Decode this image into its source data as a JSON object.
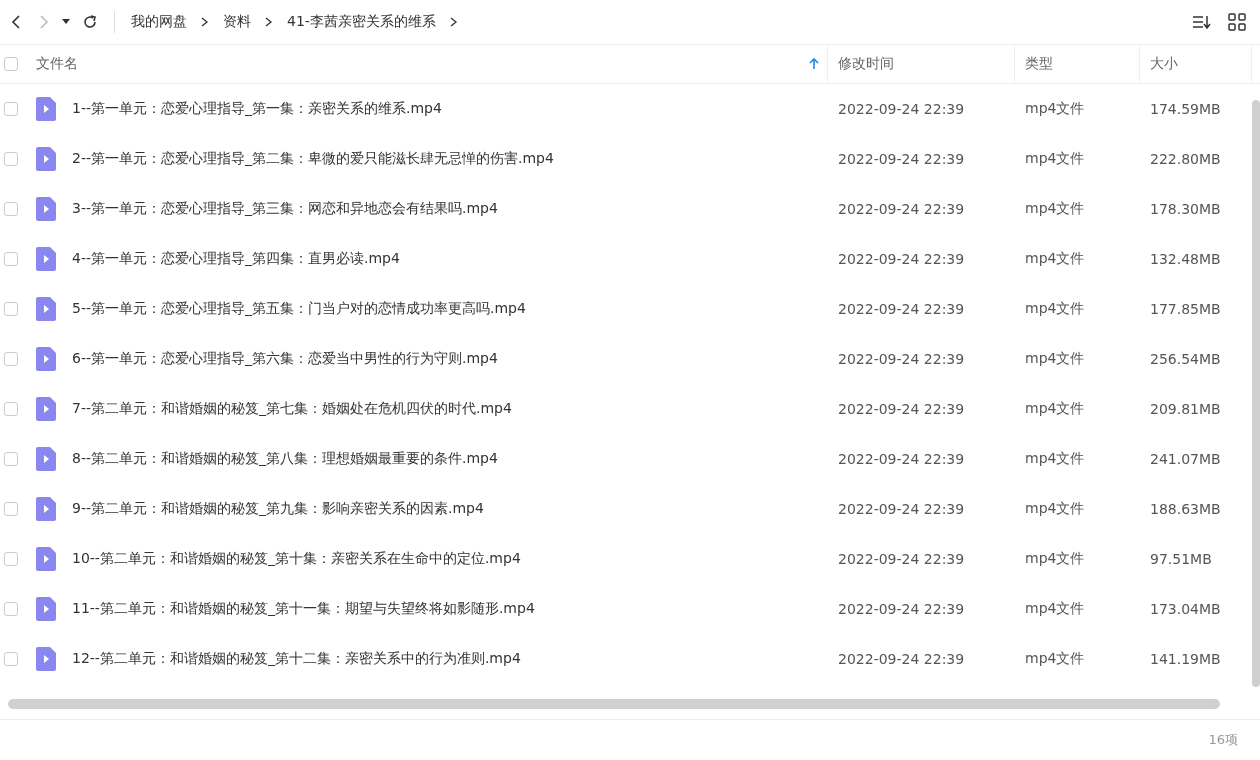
{
  "breadcrumb": [
    "我的网盘",
    "资料",
    "41-李茜亲密关系的维系"
  ],
  "table": {
    "select_all": {
      "checked": false
    },
    "columns": [
      {
        "label": "文件名",
        "sorted": true
      },
      {
        "label": "修改时间",
        "sorted": false
      },
      {
        "label": "类型",
        "sorted": false
      },
      {
        "label": "大小",
        "sorted": false
      }
    ],
    "rows": [
      {
        "checked": false,
        "name": "1--第一单元：恋爱心理指导_第一集：亲密关系的维系.mp4",
        "modified": "2022-09-24 22:39",
        "type": "mp4文件",
        "size": "174.59MB"
      },
      {
        "checked": false,
        "name": "2--第一单元：恋爱心理指导_第二集：卑微的爱只能滋长肆无忌惮的伤害.mp4",
        "modified": "2022-09-24 22:39",
        "type": "mp4文件",
        "size": "222.80MB"
      },
      {
        "checked": false,
        "name": "3--第一单元：恋爱心理指导_第三集：网恋和异地恋会有结果吗.mp4",
        "modified": "2022-09-24 22:39",
        "type": "mp4文件",
        "size": "178.30MB"
      },
      {
        "checked": false,
        "name": "4--第一单元：恋爱心理指导_第四集：直男必读.mp4",
        "modified": "2022-09-24 22:39",
        "type": "mp4文件",
        "size": "132.48MB"
      },
      {
        "checked": false,
        "name": "5--第一单元：恋爱心理指导_第五集：门当户对的恋情成功率更高吗.mp4",
        "modified": "2022-09-24 22:39",
        "type": "mp4文件",
        "size": "177.85MB"
      },
      {
        "checked": false,
        "name": "6--第一单元：恋爱心理指导_第六集：恋爱当中男性的行为守则.mp4",
        "modified": "2022-09-24 22:39",
        "type": "mp4文件",
        "size": "256.54MB"
      },
      {
        "checked": false,
        "name": "7--第二单元：和谐婚姻的秘笈_第七集：婚姻处在危机四伏的时代.mp4",
        "modified": "2022-09-24 22:39",
        "type": "mp4文件",
        "size": "209.81MB"
      },
      {
        "checked": false,
        "name": "8--第二单元：和谐婚姻的秘笈_第八集：理想婚姻最重要的条件.mp4",
        "modified": "2022-09-24 22:39",
        "type": "mp4文件",
        "size": "241.07MB"
      },
      {
        "checked": false,
        "name": "9--第二单元：和谐婚姻的秘笈_第九集：影响亲密关系的因素.mp4",
        "modified": "2022-09-24 22:39",
        "type": "mp4文件",
        "size": "188.63MB"
      },
      {
        "checked": false,
        "name": "10--第二单元：和谐婚姻的秘笈_第十集：亲密关系在生命中的定位.mp4",
        "modified": "2022-09-24 22:39",
        "type": "mp4文件",
        "size": "97.51MB"
      },
      {
        "checked": false,
        "name": "11--第二单元：和谐婚姻的秘笈_第十一集：期望与失望终将如影随形.mp4",
        "modified": "2022-09-24 22:39",
        "type": "mp4文件",
        "size": "173.04MB"
      },
      {
        "checked": false,
        "name": "12--第二单元：和谐婚姻的秘笈_第十二集：亲密关系中的行为准则.mp4",
        "modified": "2022-09-24 22:39",
        "type": "mp4文件",
        "size": "141.19MB"
      }
    ]
  },
  "status_bar": {
    "count": "16项"
  }
}
